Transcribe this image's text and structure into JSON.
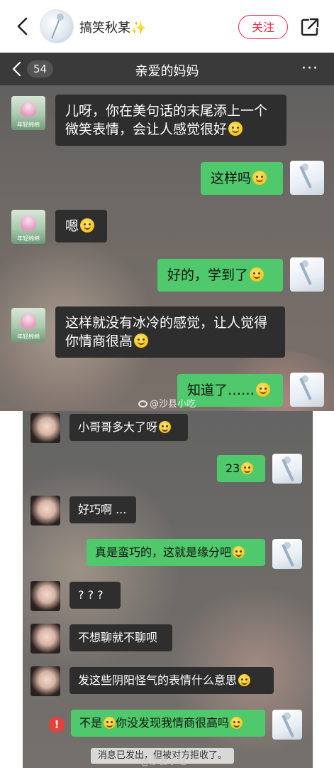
{
  "post_header": {
    "author_name": "搞笑秋某✨",
    "follow_label": "关注",
    "icons": [
      "back-icon",
      "share-icon"
    ]
  },
  "chat1": {
    "back_count": "54",
    "title": "亲爱的妈妈",
    "more_label": "···",
    "avatar_caption": "年轻绵绵",
    "messages": [
      {
        "side": "left",
        "text_line1": "儿呀，你在美句话的末尾添上一个",
        "text_line2": "微笑表情，会让人感觉很好",
        "emoji": true
      },
      {
        "side": "right",
        "text": "这样吗",
        "emoji": true
      },
      {
        "side": "left",
        "text": "嗯",
        "emoji": true
      },
      {
        "side": "right",
        "text": "好的，学到了",
        "emoji": true
      },
      {
        "side": "left",
        "text_line1": "这样就没有冰冷的感觉，让人觉得",
        "text_line2": "你情商很高",
        "emoji": true
      },
      {
        "side": "right",
        "text": "知道了……",
        "emoji": true
      }
    ],
    "watermark": "@沙县小吃"
  },
  "chat2": {
    "messages": [
      {
        "side": "left",
        "text": "小哥哥多大了呀",
        "emoji": true
      },
      {
        "side": "right",
        "text": "23",
        "emoji": true
      },
      {
        "side": "left",
        "text": "好巧啊 ..."
      },
      {
        "side": "right",
        "text": "真是蛮巧的，这就是缘分吧",
        "emoji": true
      },
      {
        "side": "left",
        "text": "? ? ?"
      },
      {
        "side": "left",
        "text": "不想聊就不聊呗"
      },
      {
        "side": "left",
        "text": "发这些阴阳怪气的表情什么意思",
        "emoji": true
      },
      {
        "side": "right",
        "text_a": "不是",
        "text_b": "你没发现我情商很高吗",
        "emoji": true,
        "failed": true
      }
    ],
    "error_mark": "!",
    "system_notice": "消息已发出，但被对方拒收了。",
    "watermark": "@沙县小吃"
  },
  "colors": {
    "accent_red": "#ff2442",
    "bubble_green": "#4fc96b",
    "bubble_dark": "#2e2e2e",
    "header_dark": "#3a3a3a"
  }
}
